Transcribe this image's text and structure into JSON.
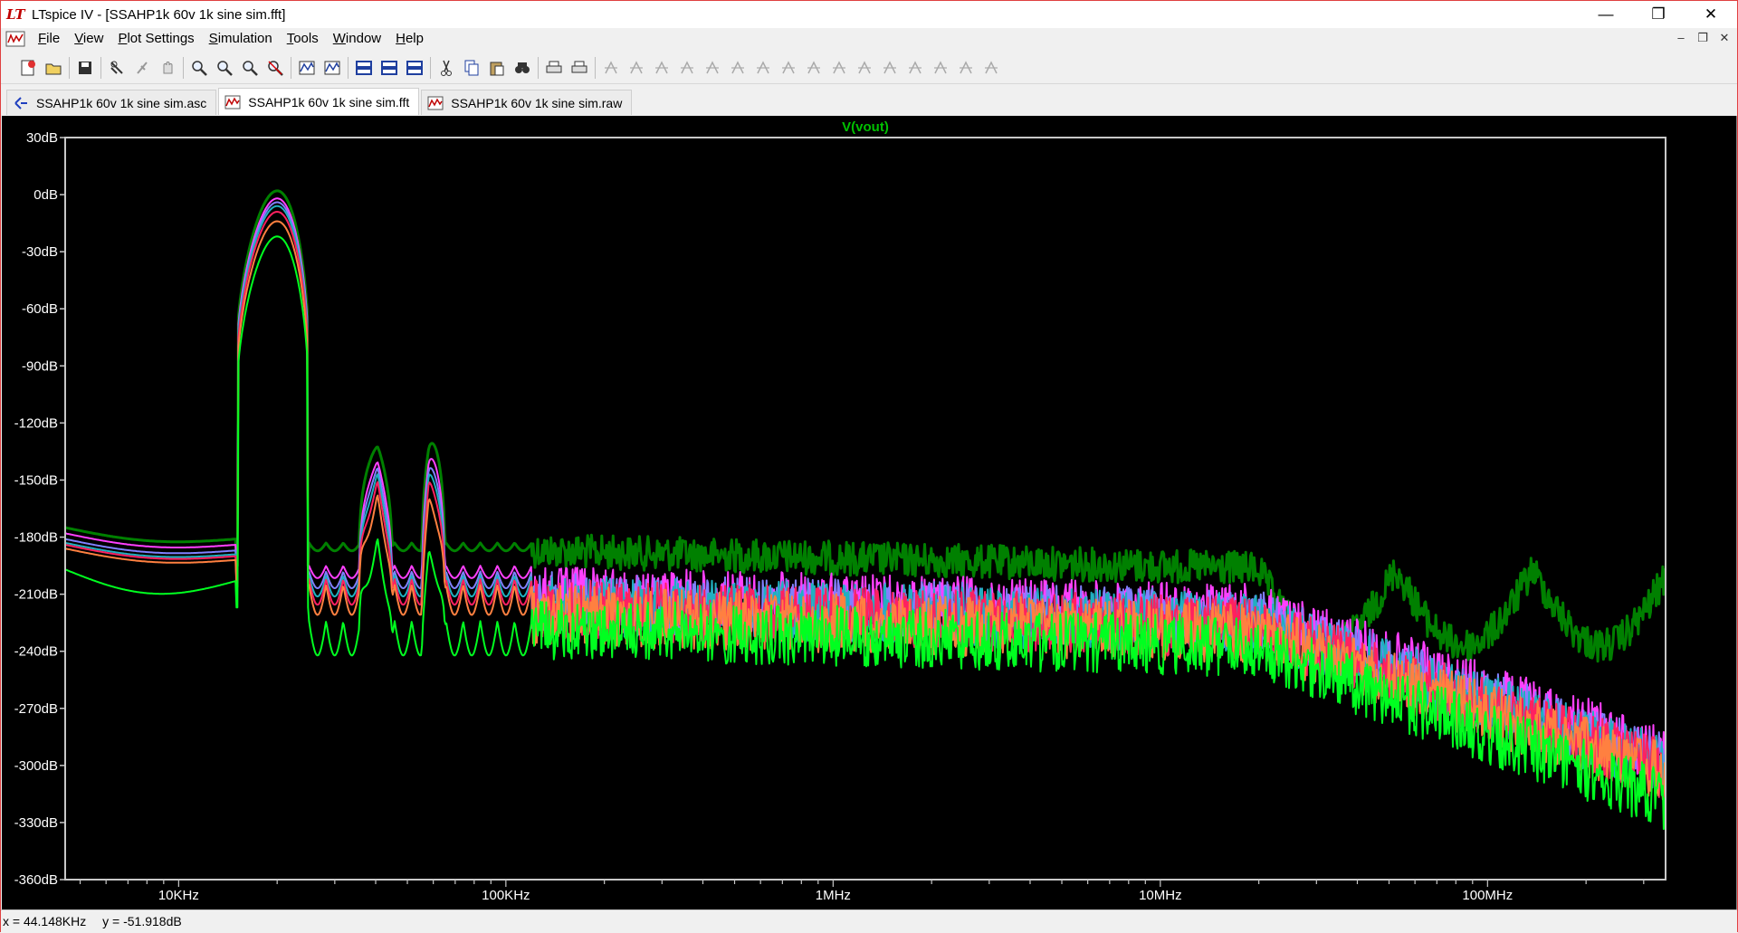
{
  "window": {
    "title": "LTspice IV - [SSAHP1k 60v 1k sine sim.fft]",
    "logo_text": "LT",
    "controls": {
      "minimize": "—",
      "restore": "❐",
      "close": "✕"
    }
  },
  "menu": {
    "items": [
      {
        "key": "F",
        "rest": "ile"
      },
      {
        "key": "V",
        "rest": "iew"
      },
      {
        "key": "P",
        "rest": "lot Settings"
      },
      {
        "key": "S",
        "rest": "imulation"
      },
      {
        "key": "T",
        "rest": "ools"
      },
      {
        "key": "W",
        "rest": "indow"
      },
      {
        "key": "H",
        "rest": "elp"
      }
    ],
    "mdi_controls": {
      "minimize": "–",
      "restore": "❐",
      "close": "✕"
    }
  },
  "toolbar": {
    "groups": [
      [
        "new-schematic-icon",
        "open-icon"
      ],
      [
        "save-icon"
      ],
      [
        "control-panel-icon",
        "run-icon",
        "halt-icon"
      ],
      [
        "zoom-in-icon",
        "zoom-out-icon",
        "zoom-full-icon",
        "zoom-cancel-icon"
      ],
      [
        "autorange-icon",
        "vertical-range-icon"
      ],
      [
        "tile-horizontal-icon",
        "cascade-icon",
        "tile-vertical-icon"
      ],
      [
        "cut-icon",
        "copy-icon",
        "paste-icon",
        "find-icon"
      ],
      [
        "print-preview-icon",
        "print-icon"
      ],
      [
        "wire-icon",
        "ground-icon",
        "label-icon",
        "resistor-icon",
        "capacitor-icon",
        "inductor-icon",
        "diode-icon",
        "component-icon",
        "move-icon",
        "drag-icon",
        "undo-icon",
        "redo-icon",
        "rotate-icon",
        "mirror-icon",
        "text-icon",
        "spice-directive-icon"
      ]
    ],
    "accent": "#1f3f9f"
  },
  "tabs": [
    {
      "label": "SSAHP1k 60v 1k sine sim.asc",
      "icon": "schematic-icon",
      "active": false
    },
    {
      "label": "SSAHP1k 60v 1k sine sim.fft",
      "icon": "waveform-icon",
      "active": true
    },
    {
      "label": "SSAHP1k 60v 1k sine sim.raw",
      "icon": "waveform-icon",
      "active": false
    }
  ],
  "status": {
    "x_readout": "x = 44.148KHz",
    "y_readout": "y = -51.918dB"
  },
  "chart_data": {
    "type": "line",
    "title": "V(vout)",
    "xscale": "log",
    "xlim": [
      4500,
      350000000
    ],
    "ylim": [
      -360,
      30
    ],
    "x_ticks": [
      {
        "value": 10000,
        "label": "10KHz"
      },
      {
        "value": 100000,
        "label": "100KHz"
      },
      {
        "value": 1000000,
        "label": "1MHz"
      },
      {
        "value": 10000000,
        "label": "10MHz"
      },
      {
        "value": 100000000,
        "label": "100MHz"
      }
    ],
    "y_ticks": [
      {
        "value": 30,
        "label": "30dB"
      },
      {
        "value": 0,
        "label": "0dB"
      },
      {
        "value": -30,
        "label": "-30dB"
      },
      {
        "value": -60,
        "label": "-60dB"
      },
      {
        "value": -90,
        "label": "-90dB"
      },
      {
        "value": -120,
        "label": "-120dB"
      },
      {
        "value": -150,
        "label": "-150dB"
      },
      {
        "value": -180,
        "label": "-180dB"
      },
      {
        "value": -210,
        "label": "-210dB"
      },
      {
        "value": -240,
        "label": "-240dB"
      },
      {
        "value": -270,
        "label": "-270dB"
      },
      {
        "value": -300,
        "label": "-300dB"
      },
      {
        "value": -330,
        "label": "-330dB"
      },
      {
        "value": -360,
        "label": "-360dB"
      }
    ],
    "grid": false,
    "background": "#000000",
    "frame_color": "#c8c8c8",
    "label_color": "#00c000",
    "series": [
      {
        "color": "#008000",
        "fundamental_db": 2,
        "h2_db": -132,
        "h3_db": -128,
        "floor_low_db": -175,
        "floor_mid_db": -183,
        "floor_high_db": -233
      },
      {
        "color": "#ff40ff",
        "fundamental_db": -2,
        "h2_db": -140,
        "h3_db": -135,
        "floor_low_db": -178,
        "floor_mid_db": -195,
        "floor_high_db": -262
      },
      {
        "color": "#8080ff",
        "fundamental_db": -4,
        "h2_db": -143,
        "h3_db": -139,
        "floor_low_db": -181,
        "floor_mid_db": -198,
        "floor_high_db": -266
      },
      {
        "color": "#20b0c0",
        "fundamental_db": -6,
        "h2_db": -146,
        "h3_db": -142,
        "floor_low_db": -183,
        "floor_mid_db": -200,
        "floor_high_db": -268
      },
      {
        "color": "#ff2060",
        "fundamental_db": -9,
        "h2_db": -150,
        "h3_db": -146,
        "floor_low_db": -184,
        "floor_mid_db": -202,
        "floor_high_db": -270
      },
      {
        "color": "#ff8040",
        "fundamental_db": -14,
        "h2_db": -157,
        "h3_db": -155,
        "floor_low_db": -186,
        "floor_mid_db": -205,
        "floor_high_db": -272
      },
      {
        "color": "#00ff20",
        "fundamental_db": -22,
        "h2_db": -180,
        "h3_db": -183,
        "floor_low_db": -197,
        "floor_mid_db": -212,
        "floor_high_db": -285
      }
    ],
    "fundamental_hz": [
      15000,
      25000
    ],
    "harmonic2_hz": 40000,
    "harmonic3_hz": 60000
  }
}
